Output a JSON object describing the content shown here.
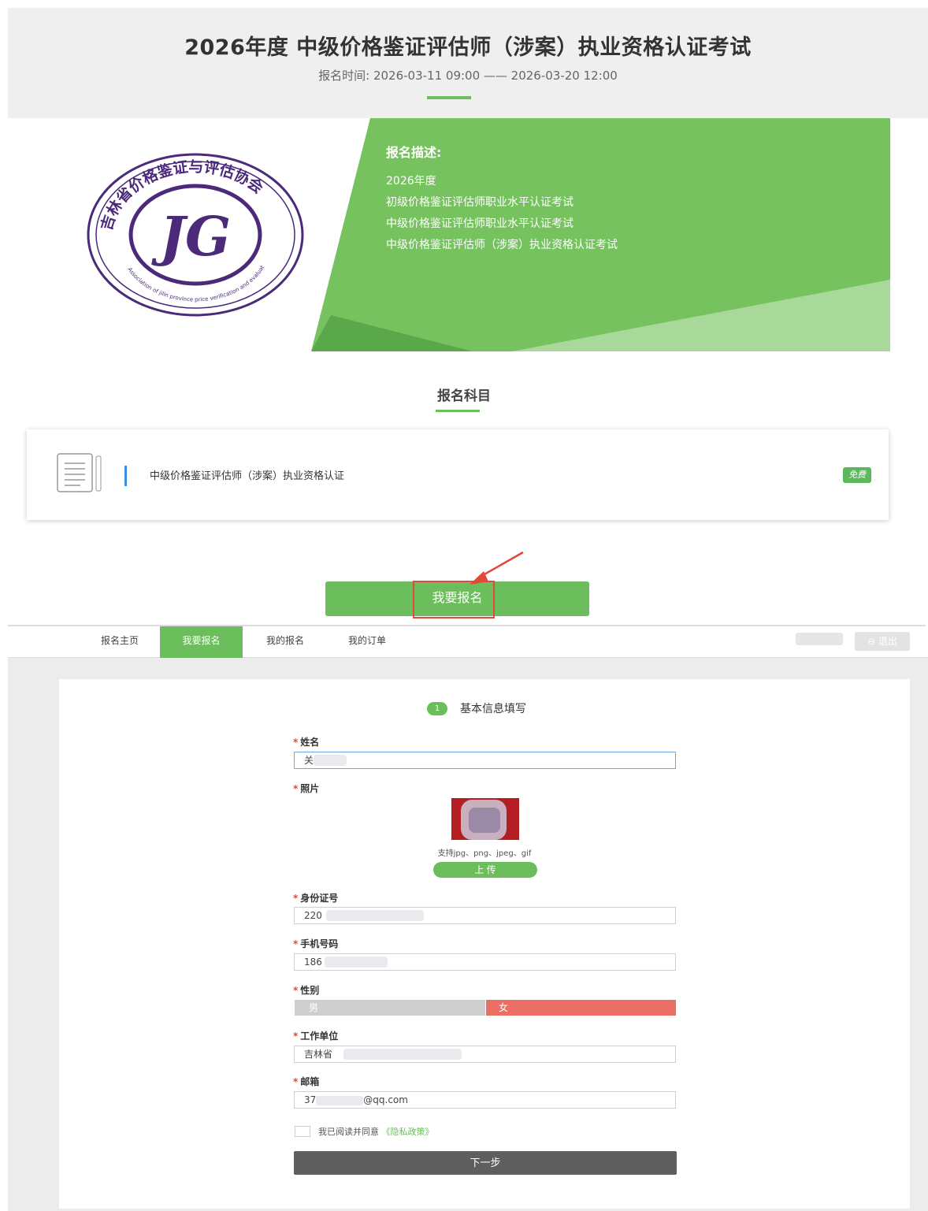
{
  "header": {
    "title": "2026年度 中级价格鉴证评估师（涉案）执业资格认证考试",
    "registration_period": "报名时间: 2026-03-11 09:00 —— 2026-03-20 12:00"
  },
  "banner": {
    "logo_text": "吉林省价格鉴证与评估协会",
    "logo_mark": "JG",
    "logo_english": "Association of jilin province price verification and evaluation",
    "description_heading": "报名描述:",
    "description_lines": [
      "2026年度",
      "初级价格鉴证评估师职业水平认证考试",
      "中级价格鉴证评估师职业水平认证考试",
      "中级价格鉴证评估师（涉案）执业资格认证考试"
    ]
  },
  "subjects": {
    "heading": "报名科目",
    "items": [
      {
        "name": "中级价格鉴证评估师（涉案）执业资格认证",
        "badge": "免费"
      }
    ]
  },
  "register_button": "我要报名",
  "nav": {
    "items": [
      "报名主页",
      "我要报名",
      "我的报名",
      "我的订单"
    ],
    "active": "我要报名",
    "logout": "⊖ 退出"
  },
  "form": {
    "step_number": "1",
    "step_title": "基本信息填写",
    "required_mark": "*",
    "name_label": "姓名",
    "name_value": "关",
    "photo_label": "照片",
    "photo_hint": "支持jpg、png、jpeg、gif",
    "upload_button": "上 传",
    "id_label": "身份证号",
    "id_value": "220",
    "phone_label": "手机号码",
    "phone_value": "186",
    "gender_label": "性别",
    "gender_male": "男",
    "gender_female": "女",
    "gender_selected": "女",
    "work_label": "工作单位",
    "work_value": "吉林省",
    "email_label": "邮箱",
    "email_value_prefix": "37",
    "email_value_suffix": "@qq.com",
    "agree_text": "我已阅读并同意",
    "privacy_link": "《隐私政策》",
    "next_button": "下一步"
  },
  "colors": {
    "accent_green": "#6cbd5b",
    "highlight_red": "#e2483d",
    "female_selected": "#ec6f65",
    "next_button": "#5e5e5e",
    "logo_purple": "#4b2a7a"
  }
}
